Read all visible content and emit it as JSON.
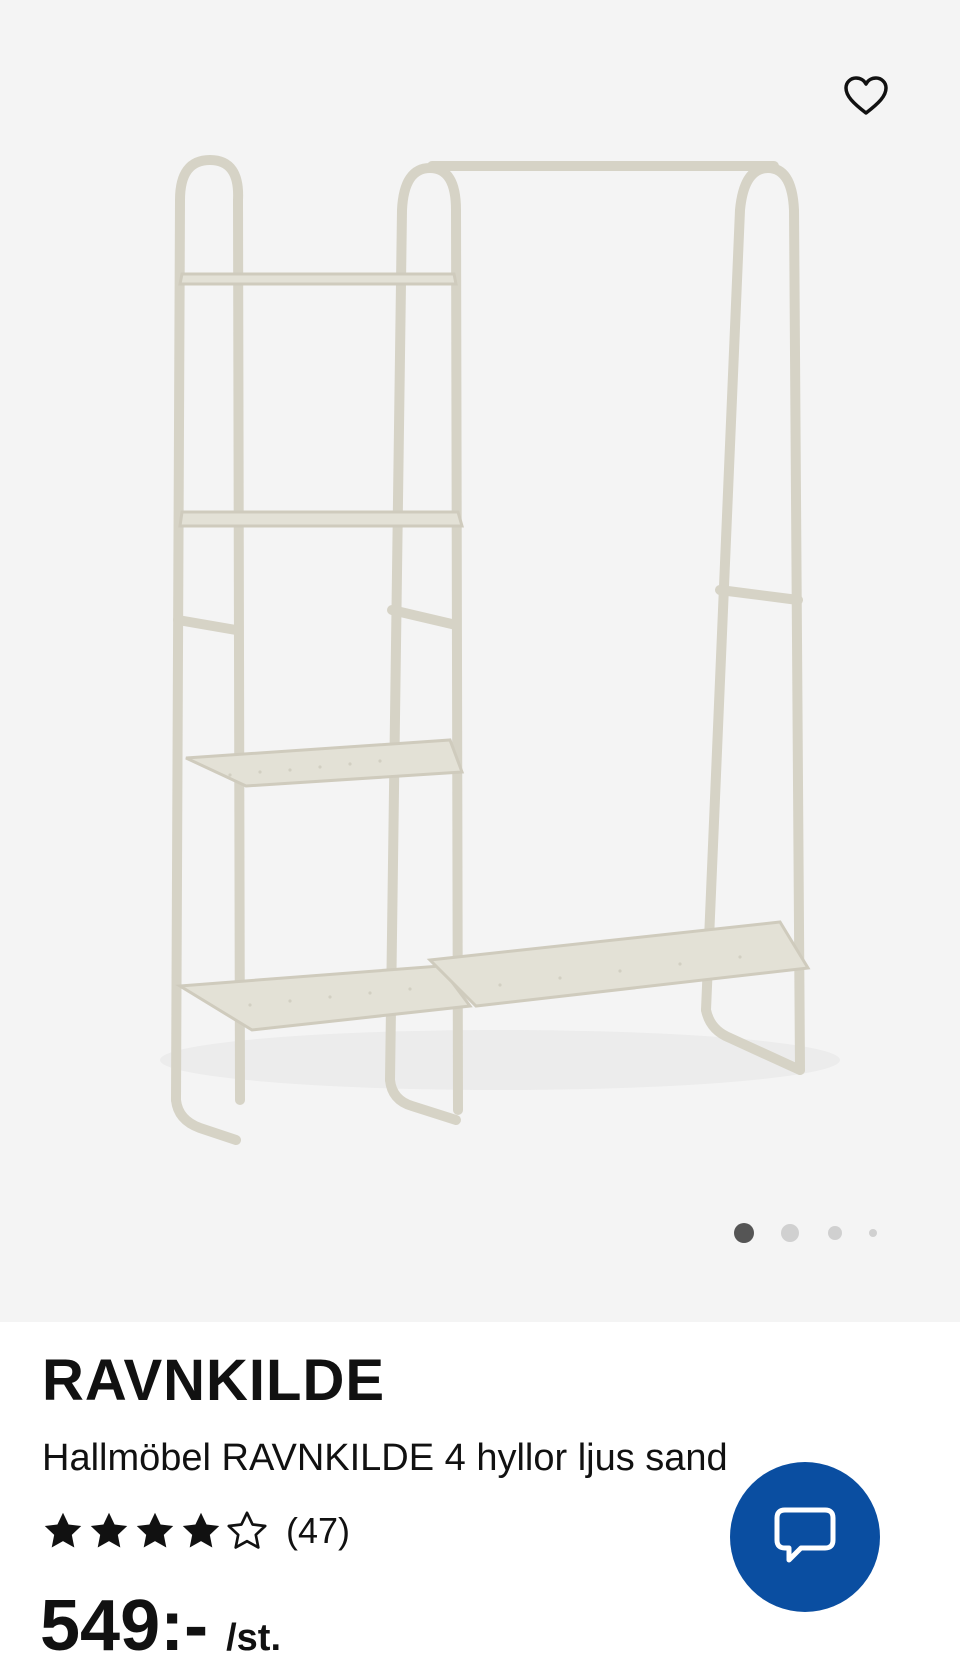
{
  "product": {
    "name": "RAVNKILDE",
    "description": "Hallmöbel RAVNKILDE 4 hyllor ljus sand",
    "rating": 4,
    "rating_max": 5,
    "review_count": "(47)",
    "price": "549:-",
    "unit": "/st."
  },
  "gallery": {
    "image_count": 4,
    "active_index": 0
  },
  "icons": {
    "wishlist": "heart-outline-icon",
    "chat": "chat-bubble-icon",
    "star_filled": "star-filled-icon",
    "star_empty": "star-outline-icon"
  },
  "colors": {
    "hero_background": "#f4f4f4",
    "frame_color": "#d6d3c6",
    "chat_button": "#0a4ea1",
    "dot_active": "#555555",
    "dot_inactive": "#d0d0d0"
  }
}
